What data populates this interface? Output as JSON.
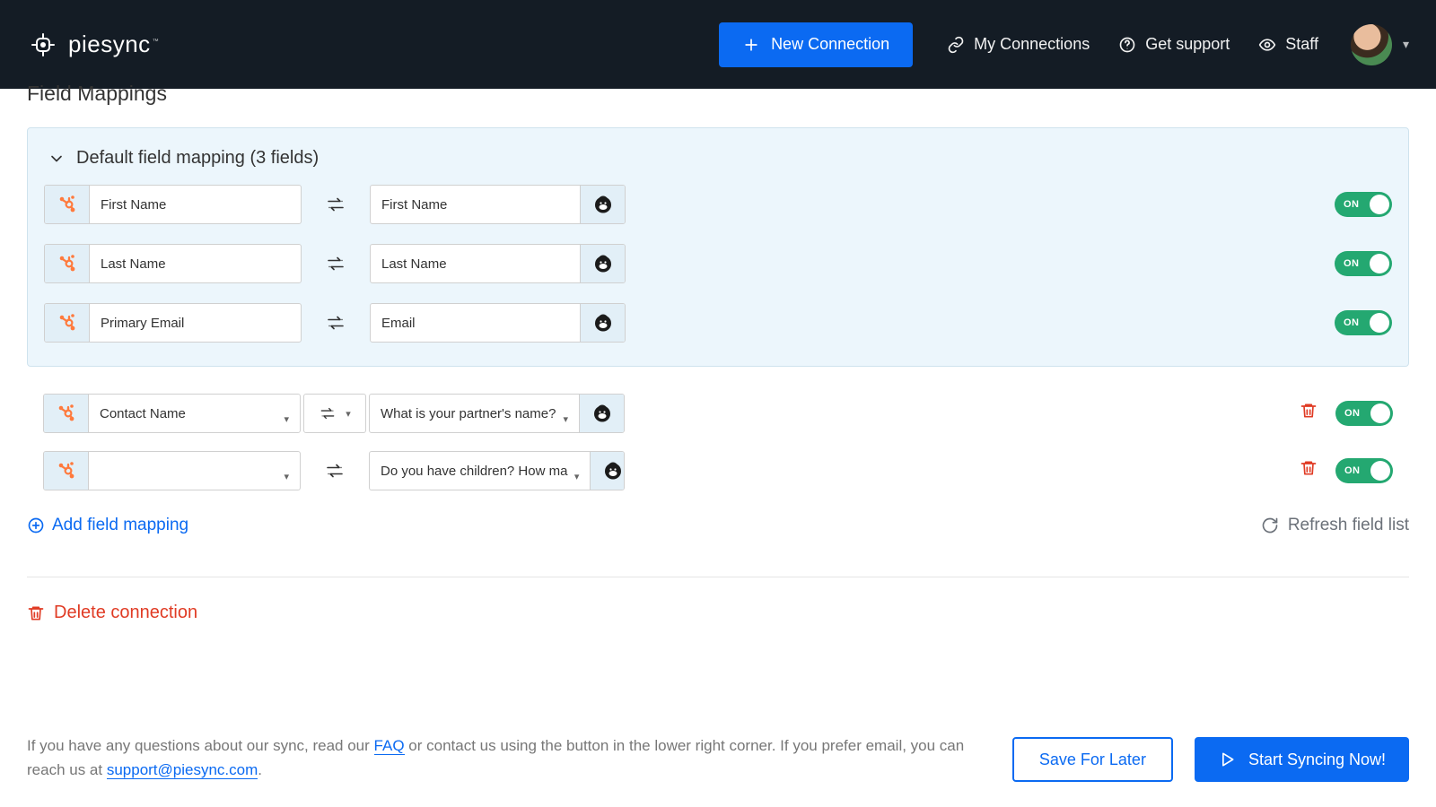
{
  "brand": {
    "name": "piesync",
    "tm": "™"
  },
  "header": {
    "new_connection": "New Connection",
    "my_connections": "My Connections",
    "get_support": "Get support",
    "staff": "Staff"
  },
  "section_title": "Field Mappings",
  "panel_title": "Default field mapping (3 fields)",
  "default_rows": [
    {
      "left": "First Name",
      "right": "First Name",
      "toggle": "ON"
    },
    {
      "left": "Last Name",
      "right": "Last Name",
      "toggle": "ON"
    },
    {
      "left": "Primary Email",
      "right": "Email",
      "toggle": "ON"
    }
  ],
  "custom_rows": [
    {
      "left": "Contact Name",
      "right": "What is your partner's name?",
      "dir_dropdown": true,
      "toggle": "ON"
    },
    {
      "left": "",
      "right": "Do you have children? How ma",
      "dir_dropdown": false,
      "toggle": "ON"
    }
  ],
  "add_field": "Add field mapping",
  "refresh_list": "Refresh field list",
  "delete_connection": "Delete connection",
  "footer_text_1": "If you have any questions about our sync, read our ",
  "footer_faq": "FAQ",
  "footer_text_2": " or contact us using the button in the lower right corner. If you prefer email, you can reach us at ",
  "support_email": "support@piesync.com",
  "footer_text_3": ".",
  "save_later": "Save For Later",
  "start_sync": "Start Syncing Now!"
}
